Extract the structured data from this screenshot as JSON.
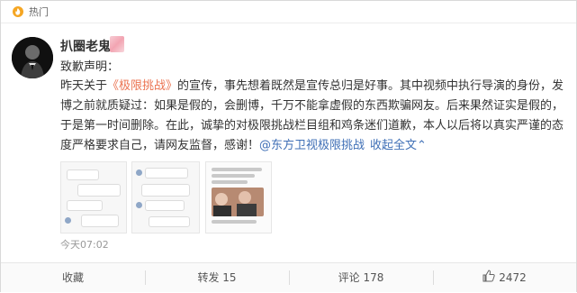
{
  "hot": {
    "label": "热门"
  },
  "post": {
    "username": "扒圈老鬼",
    "lines": {
      "l1": "致歉声明：",
      "l2_pre": "昨天关于",
      "l2_link": "《极限挑战》",
      "l2_post": "的宣传，事先想着既然是宣传总归是好事。其中视频中执行导演的身份，发",
      "l3": "博之前就质疑过：如果是假的，会删博，千万不能拿虚假的东西欺骗网友。后来果然证实是假的，",
      "l4": "于是第一时间删除。在此，诚挚的对极限挑战栏目组和鸡条迷们道歉，本人以后将以真实严谨的态",
      "l5_pre": "度严格要求自己，请网友监督，感谢！",
      "l5_mention": "@东方卫视极限挑战",
      "l5_expand": "收起全文",
      "l5_expand_icon": "chevron-up-icon"
    },
    "timestamp": "今天07:02"
  },
  "actions": {
    "favorite": "收藏",
    "repost": "转发 15",
    "comment": "评论 178",
    "like": "2472"
  },
  "colors": {
    "link": "#eb7350",
    "mention": "#3f6fb6",
    "hot_icon": "#f5a623"
  },
  "icons": {
    "hot": "fire-icon",
    "like": "thumb-up-icon"
  }
}
